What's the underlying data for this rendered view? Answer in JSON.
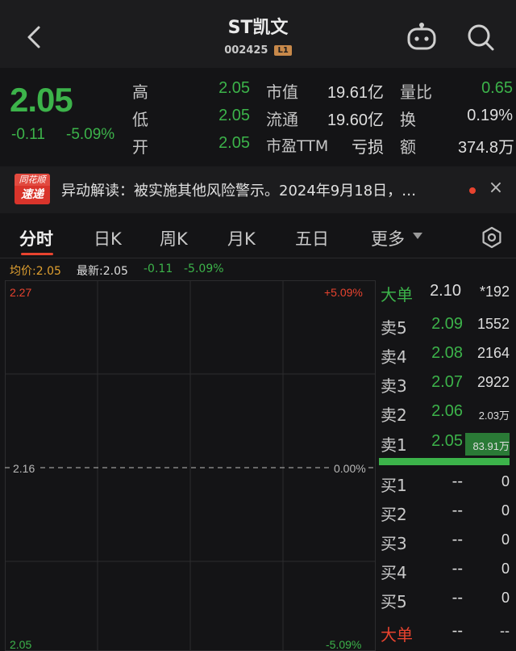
{
  "header": {
    "title": "ST凯文",
    "code": "002425",
    "level_badge": "L1"
  },
  "quote": {
    "price": "2.05",
    "change": "-0.11",
    "change_pct": "-5.09%",
    "fields": {
      "high_label": "高",
      "high_value": "2.05",
      "low_label": "低",
      "low_value": "2.05",
      "open_label": "开",
      "open_value": "2.05",
      "mcap_label": "市值",
      "mcap_value": "19.61亿",
      "float_label": "流通",
      "float_value": "19.60亿",
      "pe_label": "市盈TTM",
      "pe_value": "亏损",
      "vol_ratio_label": "量比",
      "vol_ratio_value": "0.65",
      "turnover_label": "换",
      "turnover_value": "0.19%",
      "amount_label": "额",
      "amount_value": "374.8万"
    }
  },
  "news": {
    "logo_line1": "同花顺",
    "logo_line2": "速递",
    "text": "异动解读：被实施其他风险警示。2024年9月18日，…",
    "close_glyph": "×"
  },
  "tabs": [
    {
      "label": "分时",
      "active": true
    },
    {
      "label": "日K"
    },
    {
      "label": "周K"
    },
    {
      "label": "月K"
    },
    {
      "label": "五日"
    },
    {
      "label": "更多"
    }
  ],
  "status_line": {
    "avg": "均价:2.05",
    "latest": "最新:2.05",
    "change": "-0.11",
    "change_pct": "-5.09%"
  },
  "chart_axis": {
    "top_left": "2.27",
    "top_right": "+5.09%",
    "mid_left": "2.16",
    "mid_right": "0.00%",
    "bottom_left": "2.05",
    "bottom_right": "-5.09%"
  },
  "order_book": {
    "top_big": {
      "label": "大单",
      "price": "2.10",
      "vol": "*192"
    },
    "sell": [
      {
        "label": "卖5",
        "price": "2.09",
        "vol": "1552"
      },
      {
        "label": "卖4",
        "price": "2.08",
        "vol": "2164"
      },
      {
        "label": "卖3",
        "price": "2.07",
        "vol": "2922"
      },
      {
        "label": "卖2",
        "price": "2.06",
        "vol": "2.03万"
      },
      {
        "label": "卖1",
        "price": "2.05",
        "vol": "83.91万"
      }
    ],
    "buy": [
      {
        "label": "买1",
        "price": "--",
        "vol": "0"
      },
      {
        "label": "买2",
        "price": "--",
        "vol": "0"
      },
      {
        "label": "买3",
        "price": "--",
        "vol": "0"
      },
      {
        "label": "买4",
        "price": "--",
        "vol": "0"
      },
      {
        "label": "买5",
        "price": "--",
        "vol": "0"
      }
    ],
    "bottom_big": {
      "label": "大单",
      "price": "--",
      "vol": "--"
    }
  },
  "colors": {
    "down": "#3cb34a",
    "up": "#e8432f",
    "background": "#141416"
  }
}
